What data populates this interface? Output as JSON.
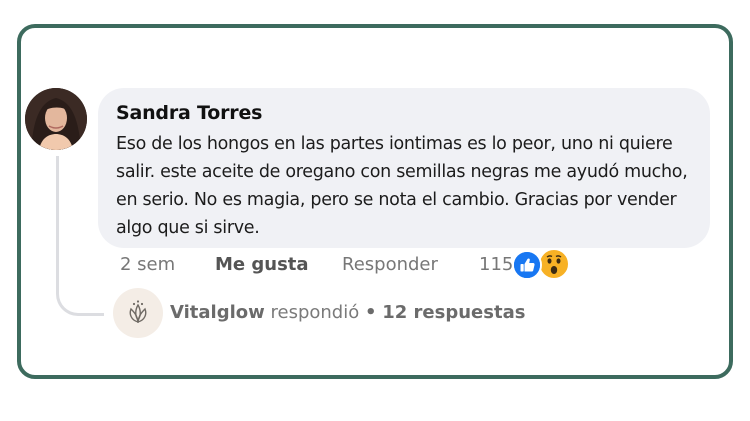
{
  "comment": {
    "author": "Sandra Torres",
    "text": "Eso de los hongos en las partes iontimas es lo peor, uno ni quiere salir. este aceite de oregano con semillas negras me ayudó mucho, en serio. No es magia, pero se nota el cambio. Gracias por vender algo que si sirve.",
    "time": "2 sem",
    "like_label": "Me gusta",
    "reply_label": "Responder",
    "reaction_count": "115",
    "reactions": [
      "like-icon",
      "wow-icon"
    ]
  },
  "reply_summary": {
    "brand": "Vitalglow",
    "action": "respondió",
    "separator": "•",
    "count_label": "12 respuestas"
  },
  "colors": {
    "card_border": "#3d6b5e",
    "bubble_bg": "#f0f1f5",
    "like_blue": "#1877f2",
    "wow_yellow": "#f7b125"
  }
}
